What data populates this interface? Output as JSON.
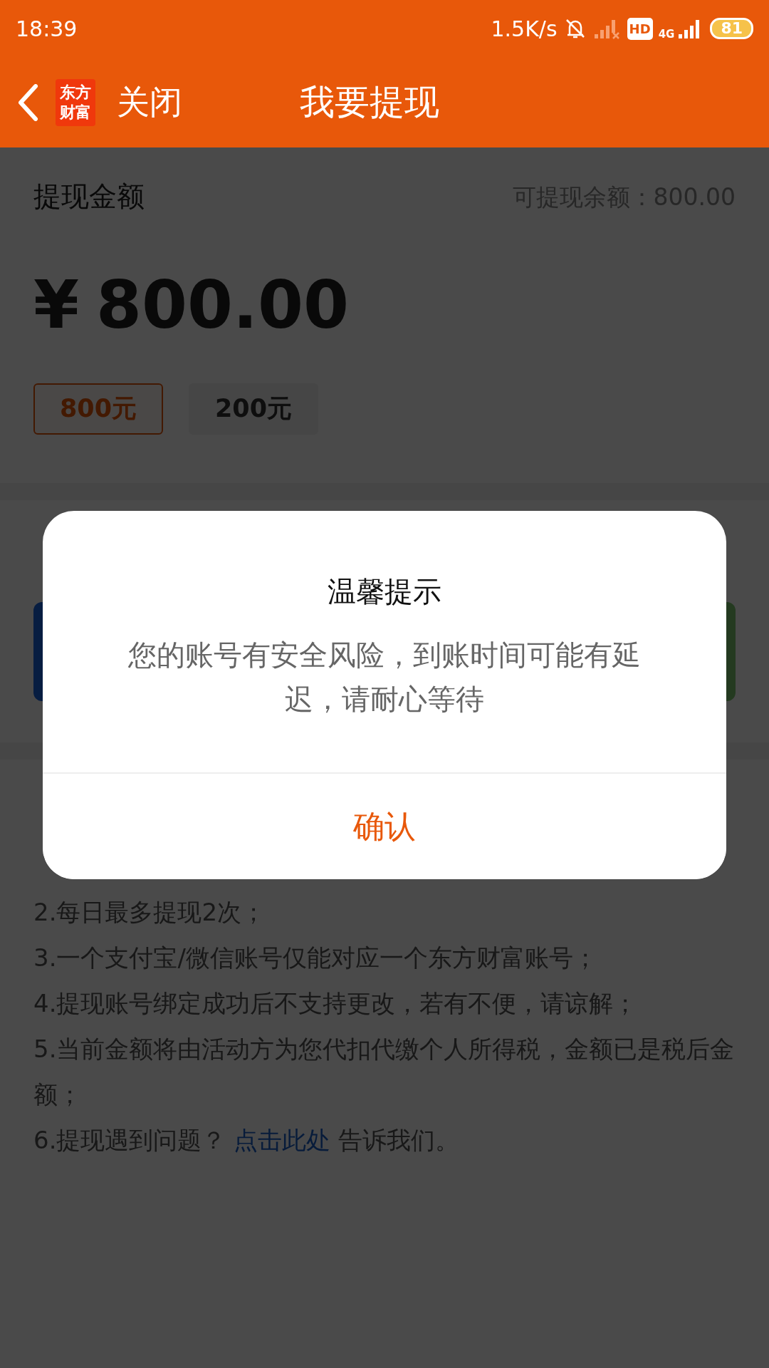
{
  "status_bar": {
    "time": "18:39",
    "speed": "1.5K/s",
    "hd": "HD",
    "network": "4G",
    "battery": "81"
  },
  "header": {
    "logo_top": "东方",
    "logo_bottom": "财富",
    "close": "关闭",
    "title": "我要提现"
  },
  "amount": {
    "label": "提现金额",
    "balance": "可提现余额：800.00",
    "currency": "¥",
    "value": "800.00"
  },
  "chips": [
    {
      "label": "800元",
      "selected": true
    },
    {
      "label": "200元",
      "selected": false
    }
  ],
  "notes": [
    {
      "text": "2.每日最多提现2次；"
    },
    {
      "text": "3.一个支付宝/微信账号仅能对应一个东方财富账号；"
    },
    {
      "text": "4.提现账号绑定成功后不支持更改，若有不便，请谅解；"
    },
    {
      "text": "5.当前金额将由活动方为您代扣代缴个人所得税，金额已是税后金额；"
    },
    {
      "text": "6.提现遇到问题？",
      "link": "点击此处",
      "after": "告诉我们。"
    }
  ],
  "dialog": {
    "title": "温馨提示",
    "message": "您的账号有安全风险，到账时间可能有延迟，请耐心等待",
    "confirm": "确认"
  }
}
